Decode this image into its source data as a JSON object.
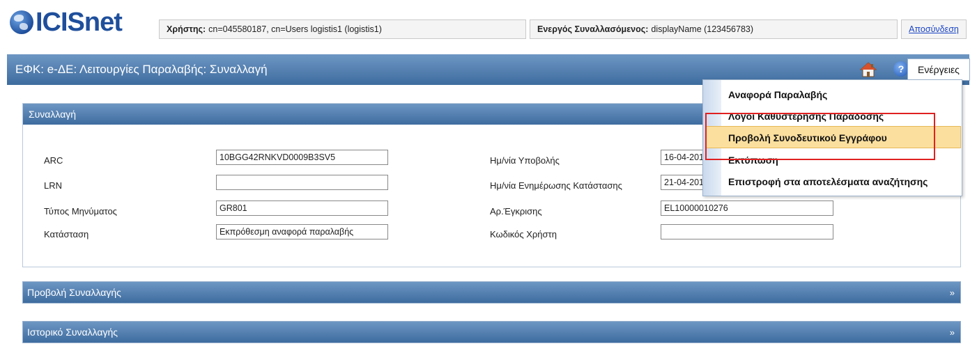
{
  "header": {
    "logo_text": "ICISnet",
    "user_label": "Χρήστης:",
    "user_value": "cn=045580187, cn=Users logistis1 (logistis1)",
    "trader_label": "Ενεργός Συναλλασόμενος:",
    "trader_value": "displayName (123456783)",
    "logout_label": "Αποσύνδεση"
  },
  "titlebar": {
    "title": "ΕΦΚ: e-ΔΕ: Λειτουργίες Παραλαβής: Συναλλαγή",
    "home_icon": "home-icon",
    "help_icon": "help-icon",
    "help_glyph": "?",
    "actions_label": "Ενέργειες"
  },
  "section": {
    "title": "Συναλλαγή",
    "left_fields": [
      {
        "label": "ARC",
        "value": "10BGG42RNKVD0009B3SV5"
      },
      {
        "label": "LRN",
        "value": ""
      },
      {
        "label": "Τύπος Μηνύματος",
        "value": "GR801"
      },
      {
        "label": "Κατάσταση",
        "value": "Εκπρόθεσμη αναφορά παραλαβής"
      }
    ],
    "right_fields": [
      {
        "label": "Ημ/νία Υποβολής",
        "value": "16-04-201"
      },
      {
        "label": "Ημ/νία Ενημέρωσης Κατάστασης",
        "value": "21-04-201"
      },
      {
        "label": "Αρ.Έγκρισης",
        "value": "EL10000010276"
      },
      {
        "label": "Κωδικός Χρήστη",
        "value": ""
      }
    ]
  },
  "collapsed_sections": [
    {
      "title": "Προβολή Συναλλαγής",
      "chevron": "»"
    },
    {
      "title": "Ιστορικό Συναλλαγής",
      "chevron": "»"
    }
  ],
  "actions_menu": {
    "items": [
      "Αναφορά Παραλαβής",
      "Λόγοι Καθυστέρησης Παράδοσης",
      "Προβολή Συνοδευτικού Εγγράφου",
      "Εκτύπωση",
      "Επιστροφή στα αποτελέσματα αναζήτησης"
    ],
    "highlighted_index": 2
  },
  "colors": {
    "header_blue": "#4a78ab",
    "highlight": "#fbdf9e",
    "annotation_red": "#e02020",
    "logo_blue": "#1f4f9c"
  }
}
